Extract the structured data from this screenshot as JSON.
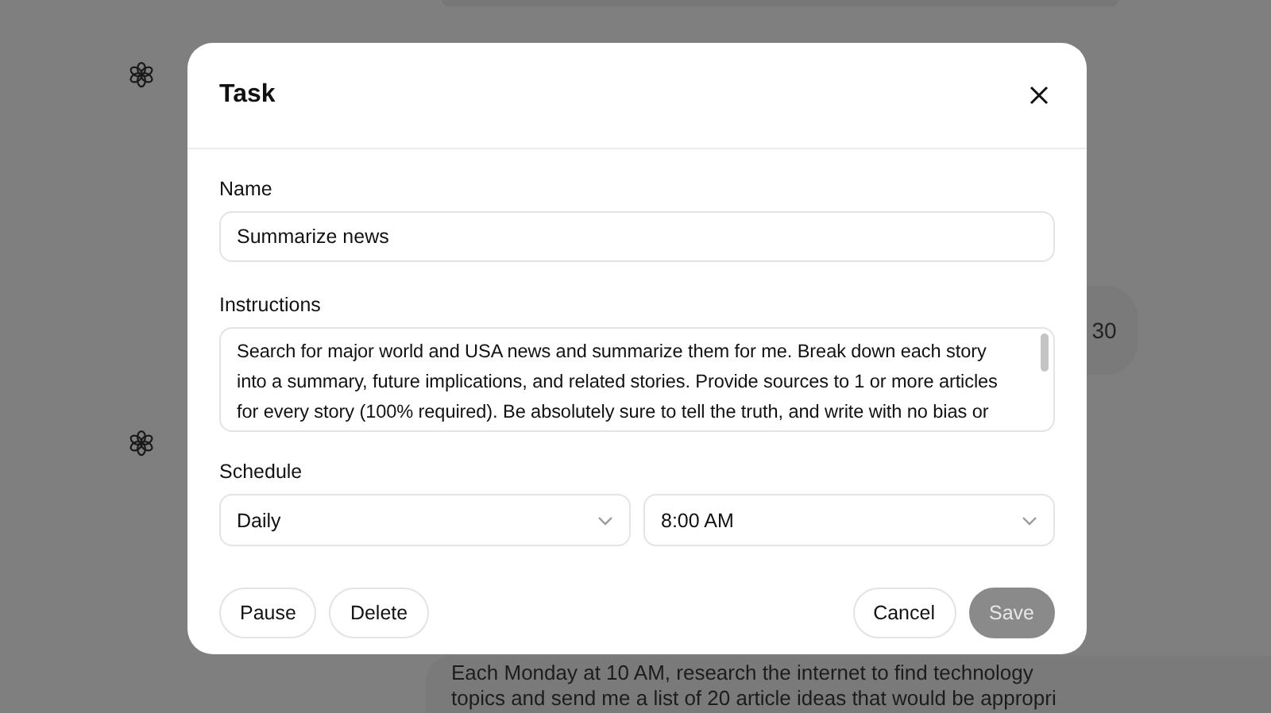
{
  "background_chat": {
    "side_bubble": "30",
    "bottom_bubble": [
      "Each Monday at 10 AM, research the internet to find technology",
      "topics and send me a list of 20 article ideas that would be appropri"
    ]
  },
  "dialog": {
    "title": "Task",
    "fields": [
      {
        "kind": "text",
        "label": "Name",
        "value": "Summarize news"
      },
      {
        "kind": "textarea",
        "label": "Instructions",
        "value": "Search for major world and USA news and summarize them for me. Break down each story into a summary, future implications, and related stories. Provide sources to 1 or more articles for every story (100% required). Be absolutely sure to tell the truth, and write with no bias or"
      }
    ],
    "schedule": {
      "label": "Schedule",
      "frequency": "Daily",
      "time": "8:00 AM"
    },
    "buttons": [
      {
        "label": "Pause",
        "kind": "secondary",
        "disabled": false
      },
      {
        "label": "Delete",
        "kind": "secondary",
        "disabled": false
      },
      {
        "label": "Cancel",
        "kind": "secondary",
        "disabled": false
      },
      {
        "label": "Save",
        "kind": "primary",
        "disabled": true
      }
    ]
  }
}
